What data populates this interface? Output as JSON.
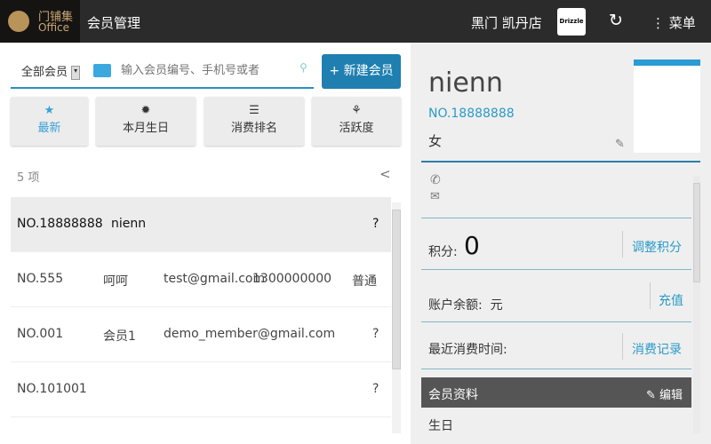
{
  "header": {
    "logo_cn": "门铺集",
    "logo_en": "Office",
    "title": "会员管理",
    "store": "黑门 凯丹店",
    "brand_logo_text": "Drizzle",
    "menu_label": "菜单"
  },
  "toolbar": {
    "filter_select": "全部会员",
    "search_placeholder": "输入会员编号、手机号或者",
    "new_member_label": "+ 新建会员"
  },
  "filters": [
    {
      "label": "最新",
      "icon": "star",
      "active": true
    },
    {
      "label": "本月生日",
      "icon": "gear"
    },
    {
      "label": "消费排名",
      "icon": "list"
    },
    {
      "label": "活跃度",
      "icon": "sprout"
    }
  ],
  "list": {
    "count_label": "5 项",
    "rows": [
      {
        "no": "NO.18888888",
        "name": "nienn",
        "email": "",
        "phone": "",
        "level": "?",
        "selected": true
      },
      {
        "no": "NO.555",
        "name": "呵呵",
        "email": "test@gmail.com",
        "phone": "1300000000",
        "level": "普通"
      },
      {
        "no": "NO.001",
        "name": "会员1",
        "email": "demo_member@gmail.com",
        "phone": "",
        "level": "?"
      },
      {
        "no": "NO.101001",
        "name": "",
        "email": "",
        "phone": "",
        "level": "?"
      }
    ]
  },
  "detail": {
    "name": "nienn",
    "no": "NO.18888888",
    "gender": "女",
    "points_label": "积分:",
    "points": "0",
    "adjust_points": "调整积分",
    "balance_label": "账户余额:  元",
    "recharge": "充值",
    "last_label": "最近消费时间:",
    "history": "消费记录",
    "profile_header": "会员资料",
    "edit": "编辑",
    "birthday_label": "生日"
  },
  "colors": {
    "accent": "#2a9bc7",
    "header_bg": "#2b2b2b",
    "button": "#1f7fb0"
  }
}
